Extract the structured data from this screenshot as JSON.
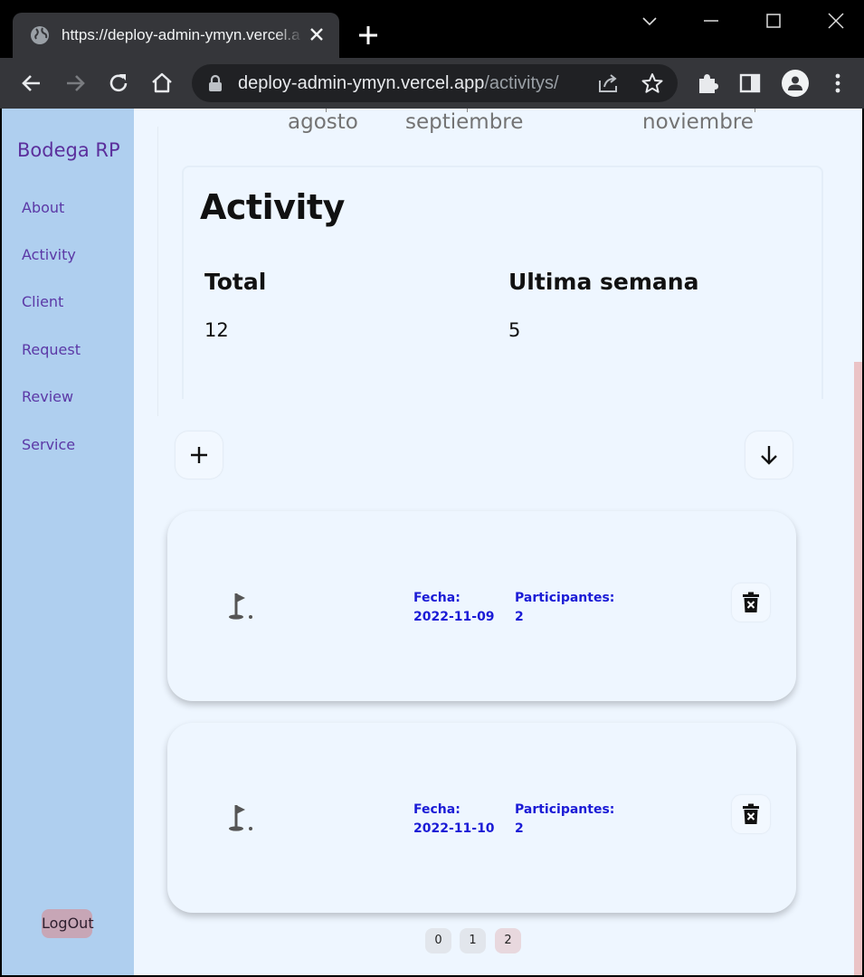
{
  "browser": {
    "tab_title": "https://deploy-admin-ymyn.vercel.app/activitys/",
    "url_host": "deploy-admin-ymyn.vercel.app",
    "url_path": "/activitys/"
  },
  "sidebar": {
    "brand": "Bodega RP",
    "items": [
      {
        "label": "About"
      },
      {
        "label": "Activity"
      },
      {
        "label": "Client"
      },
      {
        "label": "Request"
      },
      {
        "label": "Review"
      },
      {
        "label": "Service"
      }
    ],
    "logout_label": "LogOut"
  },
  "chart_tail": {
    "months": [
      "agosto",
      "septiembre",
      "noviembre"
    ]
  },
  "activity_summary": {
    "title": "Activity",
    "total_label": "Total",
    "total_value": "12",
    "week_label": "Ultima semana",
    "week_value": "5"
  },
  "activities": [
    {
      "fecha_label": "Fecha:",
      "fecha_value": "2022-11-09",
      "participantes_label": "Participantes:",
      "participantes_value": "2"
    },
    {
      "fecha_label": "Fecha:",
      "fecha_value": "2022-11-10",
      "participantes_label": "Participantes:",
      "participantes_value": "2"
    }
  ],
  "pagination": {
    "pages": [
      "0",
      "1",
      "2"
    ],
    "current": "2"
  },
  "colors": {
    "sidebar_bg": "#afcfef",
    "page_bg": "#eef6ff",
    "brand": "#5b2f9c",
    "field_text": "#1b1bd6",
    "logout_bg": "#c7a6b6"
  }
}
